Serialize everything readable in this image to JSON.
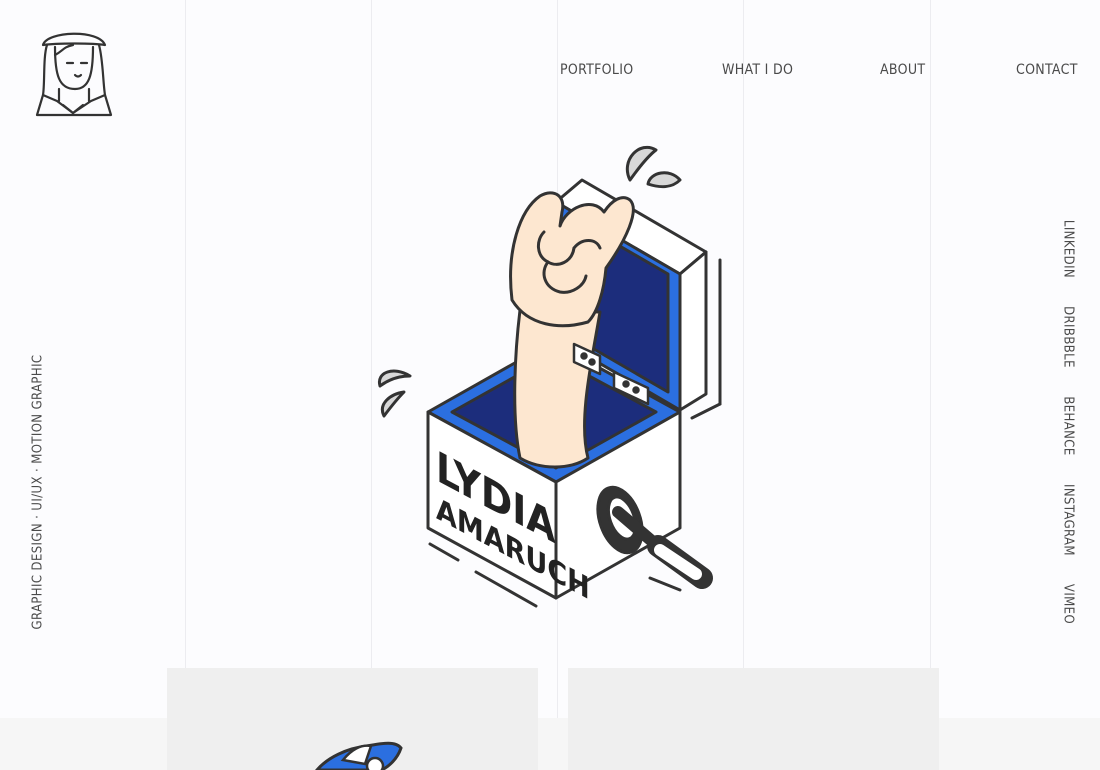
{
  "nav": {
    "items": [
      "PORTFOLIO",
      "WHAT I DO",
      "ABOUT",
      "CONTACT"
    ]
  },
  "tagline": "GRAPHIC DESIGN · UI/UX · MOTION GRAPHIC",
  "social": [
    "LINKEDIN",
    "DRIBBBLE",
    "BEHANCE",
    "INSTAGRAM",
    "VIMEO"
  ],
  "hero": {
    "box_text_line1": "LYDIA",
    "box_text_line2": "AMARUCH"
  },
  "colors": {
    "accent": "#2b6fe0",
    "accent_dark": "#1c2d7c",
    "skin": "#fde7d0",
    "line": "#333333"
  },
  "icons": [
    "logo-avatar-icon",
    "jack-in-the-box-illustration",
    "water-drop-icon",
    "crank-handle-icon"
  ]
}
